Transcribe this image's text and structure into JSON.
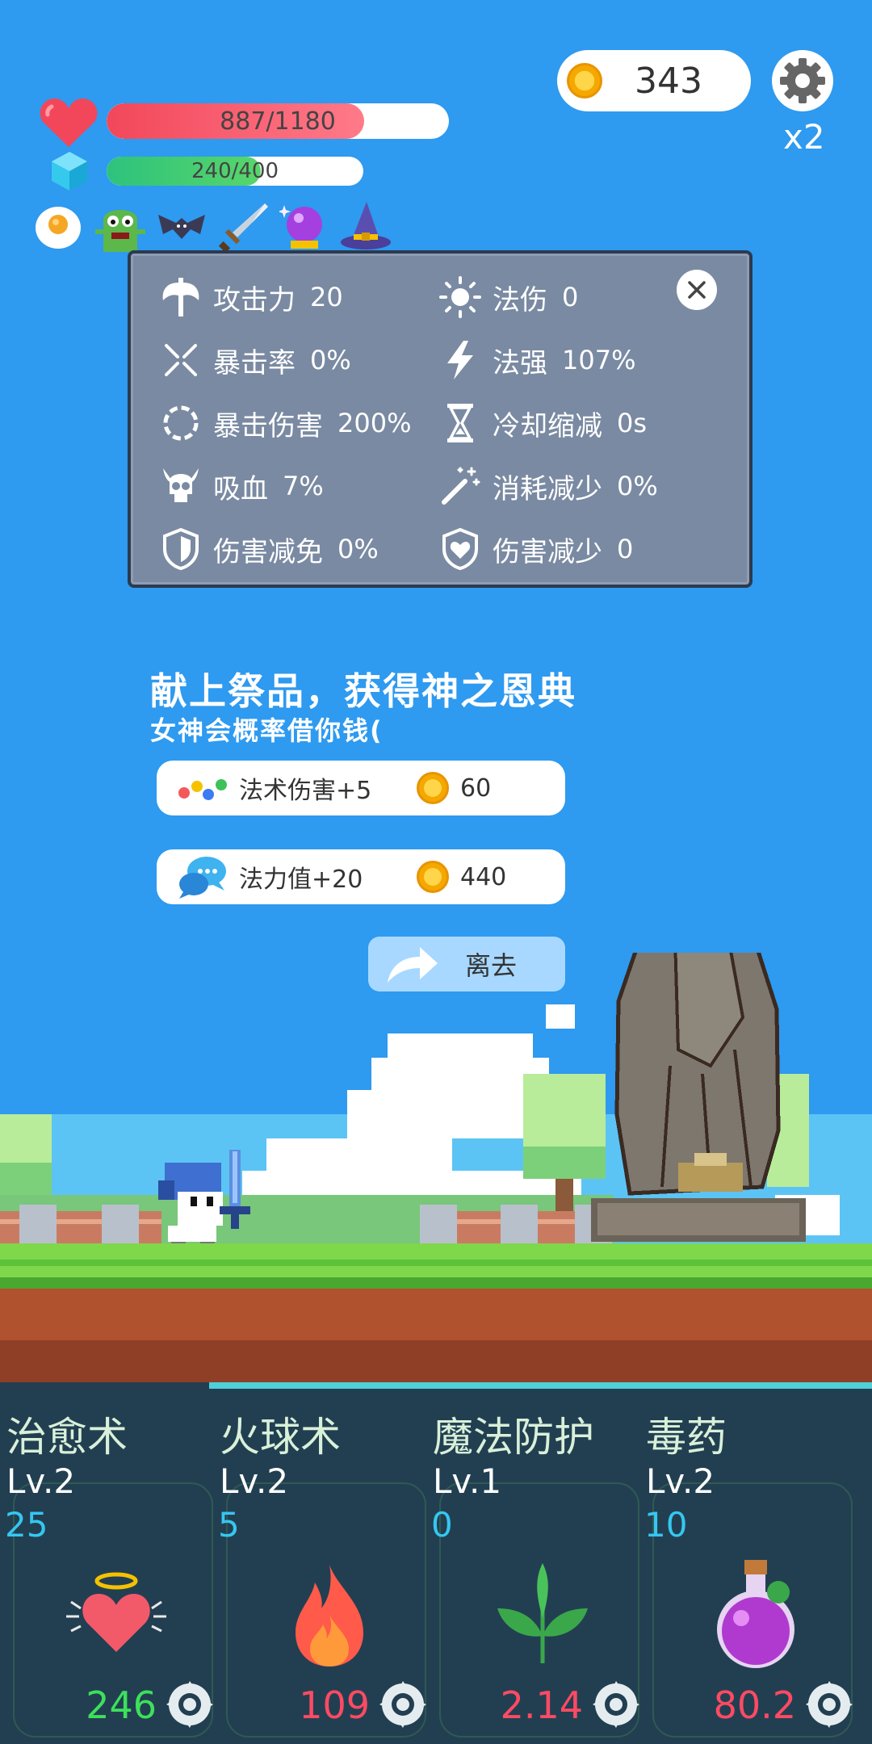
{
  "hud": {
    "coins": "343",
    "speed": "x2",
    "hp_text": "887/1180",
    "hp_fraction": 0.7517,
    "mp_text": "240/400",
    "mp_fraction": 0.6,
    "buffs": [
      "egg-icon",
      "green-monster-icon",
      "bat-icon",
      "sword-icon",
      "crystal-ball-icon",
      "wizard-hat-icon"
    ]
  },
  "stats": {
    "attack": {
      "label": "攻击力",
      "value": "20"
    },
    "magic_damage": {
      "label": "法伤",
      "value": "0"
    },
    "crit_rate": {
      "label": "暴击率",
      "value": "0%"
    },
    "spell_power": {
      "label": "法强",
      "value": "107%"
    },
    "crit_damage": {
      "label": "暴击伤害",
      "value": "200%"
    },
    "cooldown": {
      "label": "冷却缩减",
      "value": "0s"
    },
    "lifesteal": {
      "label": "吸血",
      "value": "7%"
    },
    "cost_reduction": {
      "label": "消耗减少",
      "value": "0%"
    },
    "damage_immunity": {
      "label": "伤害减免",
      "value": "0%"
    },
    "damage_reduction": {
      "label": "伤害减少",
      "value": "0"
    }
  },
  "offering": {
    "title": "献上祭品，获得神之恩典",
    "subtitle": "女神会概率借你钱(",
    "options": [
      {
        "label": "法术伤害+5",
        "price": "60"
      },
      {
        "label": "法力值+20",
        "price": "440"
      }
    ],
    "leave_label": "离去"
  },
  "skills": [
    {
      "name": "治愈术",
      "level": "Lv.2",
      "cost": "25",
      "value": "246",
      "value_color": "#3de05a",
      "icon": "heart-halo-icon"
    },
    {
      "name": "火球术",
      "level": "Lv.2",
      "cost": "5",
      "value": "109",
      "value_color": "#ff4a63",
      "icon": "fire-icon"
    },
    {
      "name": "魔法防护",
      "level": "Lv.1",
      "cost": "0",
      "value": "2.14",
      "value_color": "#ff4a63",
      "icon": "leaf-icon"
    },
    {
      "name": "毒药",
      "level": "Lv.2",
      "cost": "10",
      "value": "80.2",
      "value_color": "#ff4a63",
      "icon": "poison-potion-icon"
    }
  ]
}
